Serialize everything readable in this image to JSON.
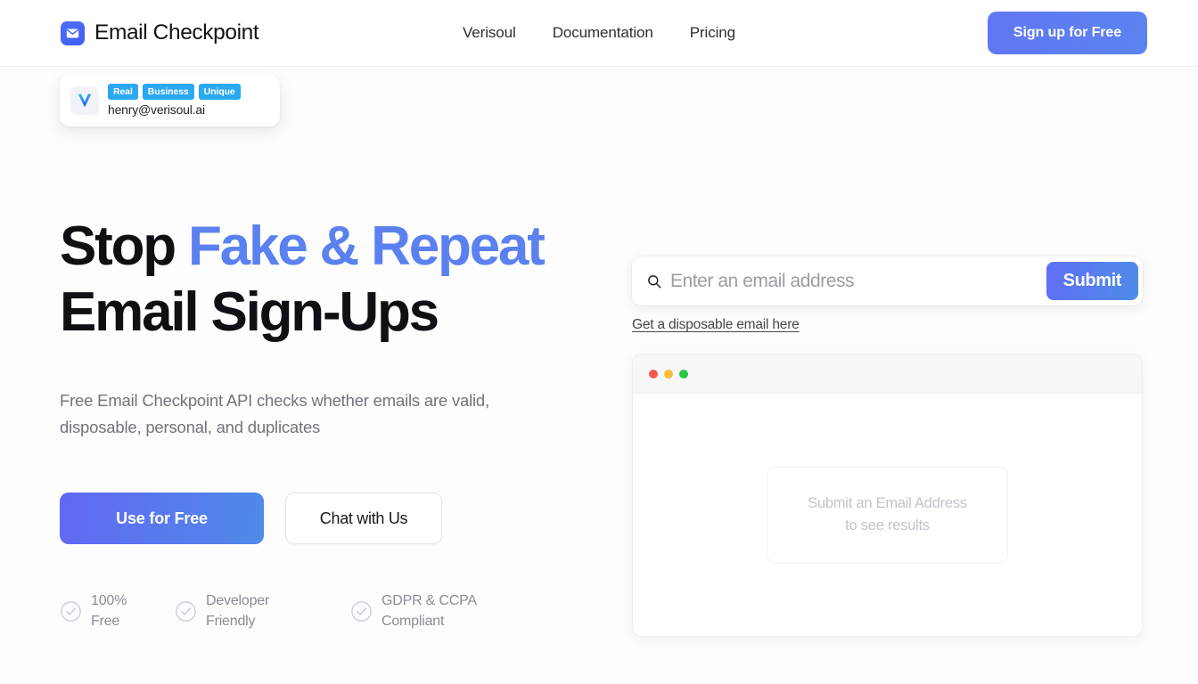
{
  "header": {
    "brand_name": "Email Checkpoint",
    "brand_icon": "envelope-icon",
    "nav": [
      {
        "label": "Verisoul"
      },
      {
        "label": "Documentation"
      },
      {
        "label": "Pricing"
      }
    ],
    "signup_label": "Sign up for Free"
  },
  "chip": {
    "avatar_letter": "V",
    "tags": [
      "Real",
      "Business",
      "Unique"
    ],
    "email": "henry@verisoul.ai"
  },
  "hero": {
    "headline_part1": "Stop ",
    "headline_accent": "Fake & Repeat",
    "headline_part2": "Email Sign-Ups",
    "subhead": "Free Email Checkpoint API checks whether emails are valid, disposable, personal, and duplicates",
    "primary_cta": "Use for Free",
    "secondary_cta": "Chat with Us",
    "features": [
      {
        "label": "100%\nFree",
        "icon": "check-circle-icon"
      },
      {
        "label": "Developer\nFriendly",
        "icon": "check-circle-icon"
      },
      {
        "label": "GDPR & CCPA\nCompliant",
        "icon": "check-circle-icon"
      }
    ]
  },
  "checker": {
    "search_placeholder": "Enter an email address",
    "search_value": "",
    "search_icon": "search-icon",
    "submit_label": "Submit",
    "disposable_link": "Get a disposable email here",
    "empty_state": "Submit an Email Address\nto see results"
  },
  "colors": {
    "accent_blue": "#5b80ef",
    "button_gradient_start": "#6168f3",
    "button_gradient_end": "#4f8ae8",
    "tag_blue": "#2aa8f2",
    "traffic_red": "#f15b52",
    "traffic_yellow": "#f6bd36",
    "traffic_green": "#28c83f",
    "text_muted": "#72737c",
    "page_background": "#fdfdfe"
  }
}
